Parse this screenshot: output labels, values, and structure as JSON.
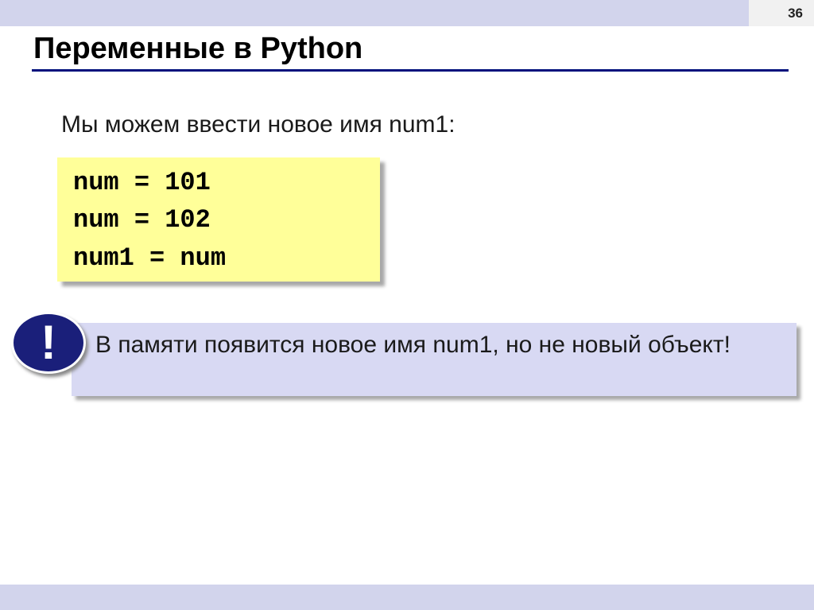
{
  "slide": {
    "page_number": "36",
    "title": "Переменные в Python",
    "intro": "Мы можем ввести новое имя num1:",
    "code_lines": [
      "num = 101",
      "num = 102",
      "num1 = num"
    ],
    "alert_symbol": "!",
    "note": "В памяти появится новое имя num1, но не новый объект!"
  },
  "colors": {
    "band": "#d2d4ec",
    "title_rule": "#00107c",
    "code_background": "#ffff99",
    "note_background": "#d8d9f3",
    "alert_badge": "#1a1f7a"
  },
  "icons": {
    "alert": "exclamation-icon"
  }
}
